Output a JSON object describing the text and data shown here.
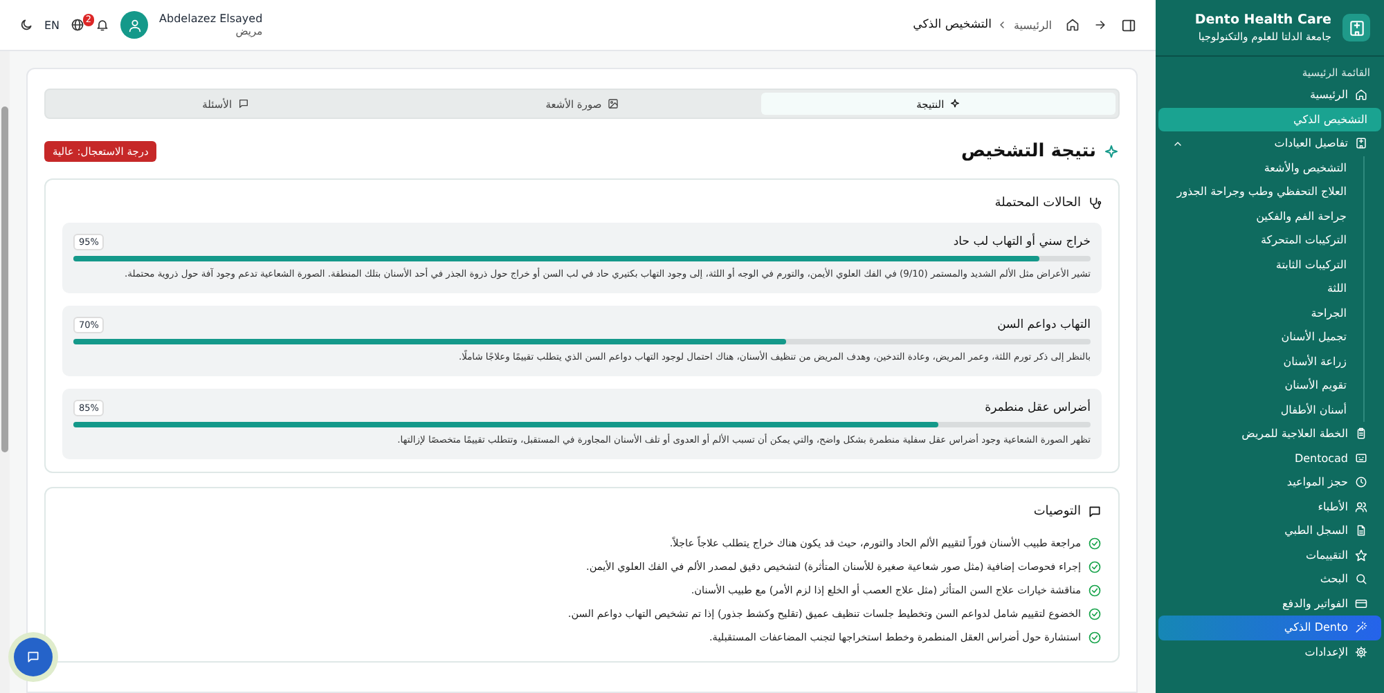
{
  "sidebar": {
    "brand": {
      "title": "Dento Health Care",
      "subtitle": "جامعة الدلتا للعلوم والتكنولوجيا"
    },
    "section_label": "القائمة الرئيسية",
    "items": [
      {
        "label": "الرئيسية",
        "kind": "link",
        "selected": false
      },
      {
        "label": "التشخيص الذكي",
        "kind": "link",
        "selected": true
      },
      {
        "label": "تفاصيل العيادات",
        "kind": "group",
        "selected": false,
        "expanded": true,
        "children": [
          {
            "label": "التشخيص والأشعة",
            "selected": false
          },
          {
            "label": "العلاج التحفظي وطب وجراحة الجذور",
            "selected": false
          },
          {
            "label": "جراحة الفم والفكين",
            "selected": false
          },
          {
            "label": "التركيبات المتحركة",
            "selected": false
          },
          {
            "label": "التركيبات الثابتة",
            "selected": false
          },
          {
            "label": "اللثة",
            "selected": false
          },
          {
            "label": "الجراحة",
            "selected": false
          },
          {
            "label": "تجميل الأسنان",
            "selected": false
          },
          {
            "label": "زراعة الأسنان",
            "selected": false
          },
          {
            "label": "تقويم الأسنان",
            "selected": false
          },
          {
            "label": "أسنان الأطفال",
            "selected": false
          }
        ]
      },
      {
        "label": "الخطة العلاجية للمريض",
        "kind": "link",
        "selected": false
      },
      {
        "label": "Dentocad",
        "kind": "link",
        "selected": false
      },
      {
        "label": "حجز المواعيد",
        "kind": "link",
        "selected": false
      },
      {
        "label": "الأطباء",
        "kind": "link",
        "selected": false
      },
      {
        "label": "السجل الطبي",
        "kind": "link",
        "selected": false
      },
      {
        "label": "التقييمات",
        "kind": "link",
        "selected": false
      },
      {
        "label": "البحث",
        "kind": "link",
        "selected": false
      },
      {
        "label": "الفواتير والدفع",
        "kind": "link",
        "selected": false
      },
      {
        "label": "Dento الذكي",
        "kind": "featured",
        "selected": false
      },
      {
        "label": "الإعدادات",
        "kind": "link",
        "selected": false
      }
    ]
  },
  "header": {
    "breadcrumb": [
      "الرئيسية",
      "التشخيص الذكي"
    ],
    "language": "EN",
    "notification_count": "2",
    "user": {
      "name": "Abdelazez Elsayed",
      "role": "مريض"
    }
  },
  "tabs": [
    {
      "label": "النتيجة",
      "selected": true
    },
    {
      "label": "صورة الأشعة",
      "selected": false
    },
    {
      "label": "الأسئلة",
      "selected": false
    }
  ],
  "result": {
    "title": "نتيجة التشخيص",
    "urgency": "درجة الاستعجال: عالية"
  },
  "conditions": {
    "title": "الحالات المحتملة",
    "items": [
      {
        "name": "خراج سني أو التهاب لب حاد",
        "percent": "95%",
        "level": 0.95,
        "description": "تشير الأعراض مثل الألم الشديد والمستمر (9/10) في الفك العلوي الأيمن، والتورم في الوجه أو اللثة، إلى وجود التهاب بكتيري حاد في لب السن أو خراج حول ذروة الجذر في أحد الأسنان بتلك المنطقة. الصورة الشعاعية تدعم وجود آفة حول ذروية محتملة."
      },
      {
        "name": "التهاب دواعم السن",
        "percent": "70%",
        "level": 0.7,
        "description": "بالنظر إلى ذكر تورم اللثة، وعمر المريض، وعادة التدخين، وهدف المريض من تنظيف الأسنان، هناك احتمال لوجود التهاب دواعم السن الذي يتطلب تقييمًا وعلاجًا شاملًا."
      },
      {
        "name": "أضراس عقل منطمرة",
        "percent": "85%",
        "level": 0.85,
        "description": "تظهر الصورة الشعاعية وجود أضراس عقل سفلية منطمرة بشكل واضح، والتي يمكن أن تسبب الألم أو العدوى أو تلف الأسنان المجاورة في المستقبل، وتتطلب تقييمًا متخصصًا لإزالتها."
      }
    ]
  },
  "recommendations": {
    "title": "التوصيات",
    "items": [
      "مراجعة طبيب الأسنان فوراً لتقييم الألم الحاد والتورم، حيث قد يكون هناك خراج يتطلب علاجاً عاجلاً.",
      "إجراء فحوصات إضافية (مثل صور شعاعية صغيرة للأسنان المتأثرة) لتشخيص دقيق لمصدر الألم في الفك العلوي الأيمن.",
      "مناقشة خيارات علاج السن المتأثر (مثل علاج العصب أو الخلع إذا لزم الأمر) مع طبيب الأسنان.",
      "الخضوع لتقييم شامل لدواعم السن وتخطيط جلسات تنظيف عميق (تقليح وكشط جذور) إذا تم تشخيص التهاب دواعم السن.",
      "استشارة حول أضراس العقل المنطمرة وخطط استخراجها لتجنب المضاعفات المستقبلية."
    ]
  }
}
